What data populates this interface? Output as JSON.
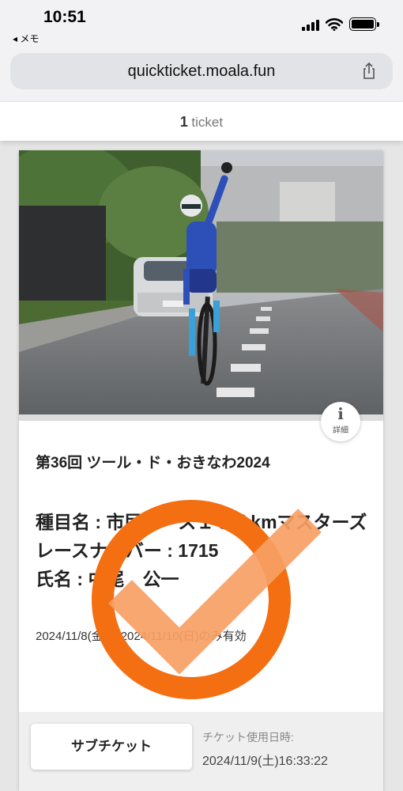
{
  "status_bar": {
    "time": "10:51",
    "back_label": "◂ メモ"
  },
  "browser": {
    "url": "quickticket.moala.fun"
  },
  "ticket_header": {
    "count": "1",
    "label": "ticket"
  },
  "ticket": {
    "info_icon_glyph": "i",
    "info_label": "詳細",
    "event_title": "第36回 ツール・ド・おきなわ2024",
    "category": "種目名 : 市民レース１００kmマスターズ",
    "race_number": "レースナンバー : 1715",
    "name": "氏名 : 中尾　公一",
    "validity": "2024/11/8(金) ~ 2024/11/10(日)のみ有効",
    "check_color": "#f36f12",
    "check_stroke_color": "#f7a064"
  },
  "footer": {
    "sub_ticket_label": "サブチケット",
    "usage_label": "チケット使用日時:",
    "usage_value": "2024/11/9(土)16:33:22"
  },
  "icons": [
    "signal-icon",
    "wifi-icon",
    "battery-icon",
    "share-icon",
    "info-icon",
    "checkmark-stamp-icon"
  ]
}
